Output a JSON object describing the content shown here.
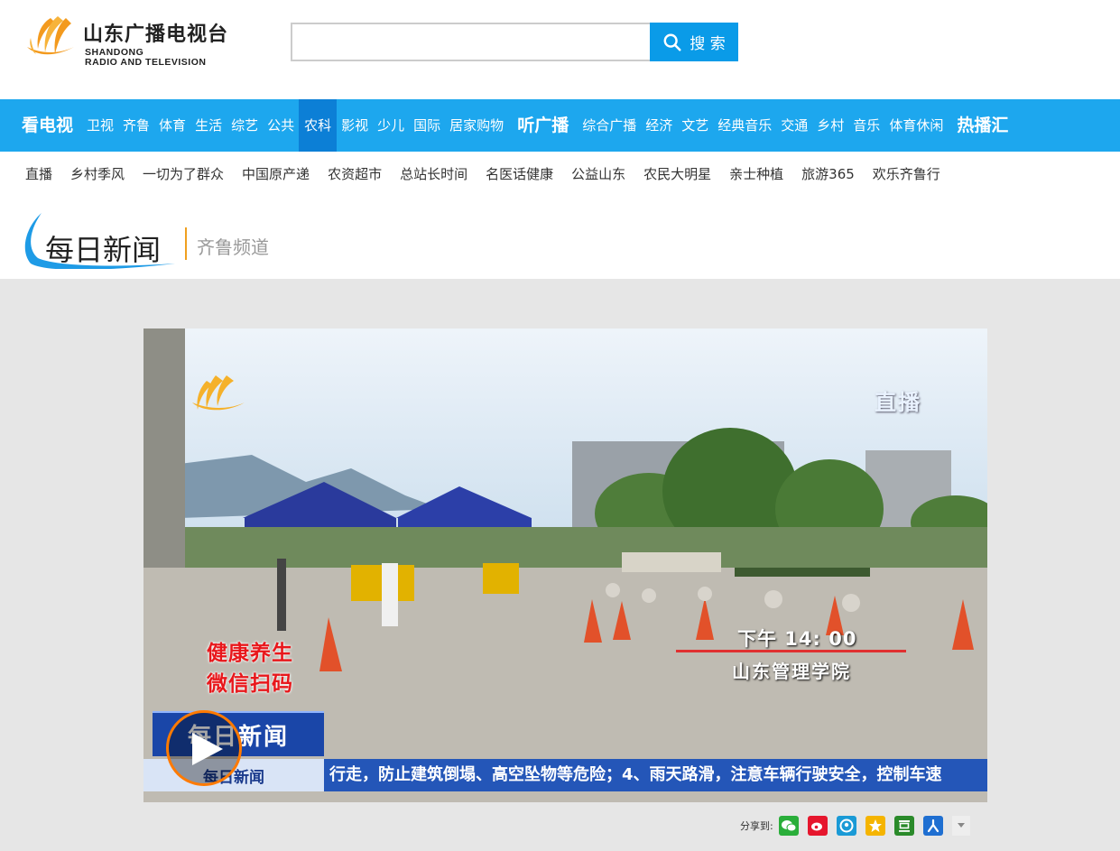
{
  "header": {
    "logo_cn": "山东广播电视台",
    "logo_en_line1": "SHANDONG",
    "logo_en_line2": "RADIO AND TELEVISION",
    "search_placeholder": "",
    "search_button": "搜 索"
  },
  "nav": {
    "items": [
      "看电视",
      "卫视",
      "齐鲁",
      "体育",
      "生活",
      "综艺",
      "公共",
      "农科",
      "影视",
      "少儿",
      "国际",
      "居家购物",
      "听广播",
      "综合广播",
      "经济",
      "文艺",
      "经典音乐",
      "交通",
      "乡村",
      "音乐",
      "体育休闲",
      "热播汇"
    ],
    "active": "农科"
  },
  "subnav": {
    "items": [
      "直播",
      "乡村季风",
      "一切为了群众",
      "中国原产递",
      "农资超市",
      "总站长时间",
      "名医话健康",
      "公益山东",
      "农民大明星",
      "亲士种植",
      "旅游365",
      "欢乐齐鲁行"
    ]
  },
  "title": {
    "program": "每日新闻",
    "channel": "齐鲁频道"
  },
  "video": {
    "live_label": "直播",
    "time": "下午 14: 00",
    "place": "山东管理学院",
    "ad_line1": "健康养生",
    "ad_line2": "微信扫码",
    "badge": "每日新闻",
    "ticker_label": "每日新闻",
    "ticker_text": "行走，防止建筑倒塌、高空坠物等危险；4、雨天路滑，注意车辆行驶安全，控制车速"
  },
  "share": {
    "label": "分享到:",
    "colors": {
      "wechat": "#2aae3a",
      "weibo": "#e6162d",
      "qqspace": "#1a9ad6",
      "qzone": "#f5b400",
      "douban": "#2a8a2a",
      "renren": "#1f6fd1"
    }
  }
}
